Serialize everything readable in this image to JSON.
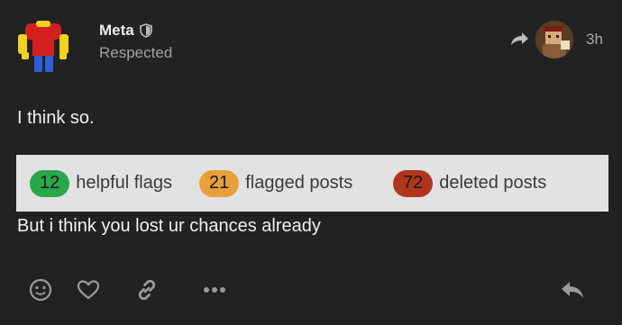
{
  "post": {
    "username": "Meta",
    "user_title": "Respected",
    "timestamp": "3h",
    "body": {
      "paragraph_1": "I think so.",
      "paragraph_2": "But i think you lost ur chances already"
    }
  },
  "stats": [
    {
      "count": "12",
      "label": "helpful flags",
      "color": "#2aa74a"
    },
    {
      "count": "21",
      "label": "flagged posts",
      "color": "#e8a03a"
    },
    {
      "count": "72",
      "label": "deleted posts",
      "color": "#b0371e"
    }
  ],
  "icons": {
    "moderator": "shield-icon",
    "reply_to": "reply-arrow-icon",
    "react": "smile-icon",
    "like": "heart-icon",
    "share": "link-icon",
    "more": "more-dots-icon",
    "reply": "reply-icon"
  },
  "colors": {
    "background": "#222222",
    "stats_background": "#e2e2e2"
  }
}
